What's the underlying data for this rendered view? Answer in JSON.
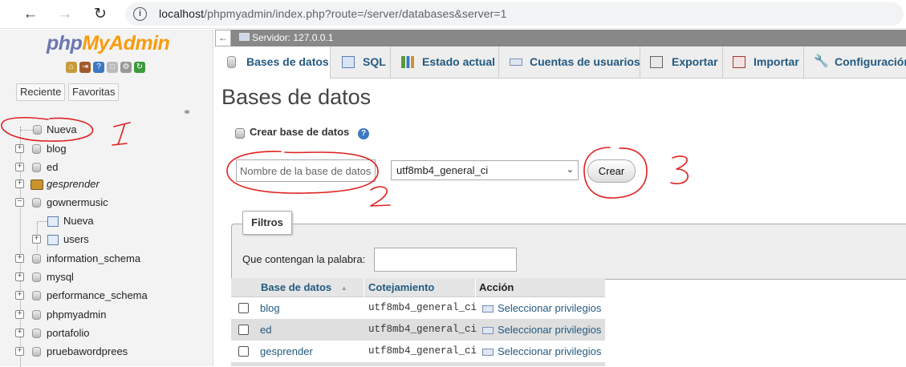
{
  "browser": {
    "url_host": "localhost",
    "url_path": "/phpmyadmin/index.php?route=/server/databases&server=1"
  },
  "logo": {
    "php": "php",
    "myadmin": "MyAdmin"
  },
  "nav_buttons": {
    "recent": "Reciente",
    "favorites": "Favoritas"
  },
  "tree": [
    {
      "label": "Nueva",
      "italic": false
    },
    {
      "label": "blog",
      "italic": false
    },
    {
      "label": "ed",
      "italic": false
    },
    {
      "label": "gesprender",
      "italic": true
    },
    {
      "label": "gownermusic",
      "italic": false
    },
    {
      "label": "Nueva",
      "italic": false
    },
    {
      "label": "users",
      "italic": false
    },
    {
      "label": "information_schema",
      "italic": false
    },
    {
      "label": "mysql",
      "italic": false
    },
    {
      "label": "performance_schema",
      "italic": false
    },
    {
      "label": "phpmyadmin",
      "italic": false
    },
    {
      "label": "portafolio",
      "italic": false
    },
    {
      "label": "pruebawordprees",
      "italic": false
    }
  ],
  "server_bar": {
    "label": "Servidor: 127.0.0.1"
  },
  "tabs": [
    {
      "label": "Bases de datos",
      "icon": "database-icon"
    },
    {
      "label": "SQL",
      "icon": "sql-icon"
    },
    {
      "label": "Estado actual",
      "icon": "status-icon"
    },
    {
      "label": "Cuentas de usuarios",
      "icon": "users-icon"
    },
    {
      "label": "Exportar",
      "icon": "export-icon"
    },
    {
      "label": "Importar",
      "icon": "import-icon"
    },
    {
      "label": "Configuración",
      "icon": "wrench-icon"
    }
  ],
  "page": {
    "title": "Bases de datos"
  },
  "create": {
    "label": "Crear base de datos",
    "name_placeholder": "Nombre de la base de datos",
    "collation": "utf8mb4_general_ci",
    "button": "Crear"
  },
  "filter": {
    "legend": "Filtros",
    "label": "Que contengan la palabra:"
  },
  "table": {
    "headers": {
      "name": "Base de datos",
      "sort": "▲",
      "collation": "Cotejamiento",
      "action": "Acción"
    },
    "rows": [
      {
        "name": "blog",
        "collation": "utf8mb4_general_ci",
        "action": "Seleccionar privilegios"
      },
      {
        "name": "ed",
        "collation": "utf8mb4_general_ci",
        "action": "Seleccionar privilegios"
      },
      {
        "name": "gesprender",
        "collation": "utf8mb4_general_ci",
        "action": "Seleccionar privilegios"
      }
    ]
  },
  "annotations": {
    "one": "1",
    "two": "2",
    "three": "3"
  },
  "colors": {
    "annotation_red": "#e02020",
    "link_blue": "#235a81",
    "logo_blue": "#6c78af",
    "logo_orange": "#f89c0e"
  }
}
